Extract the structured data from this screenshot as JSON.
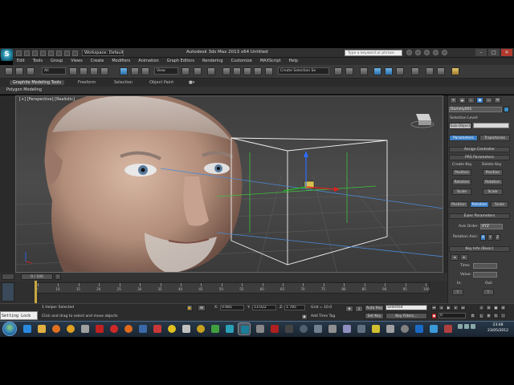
{
  "titlebar": {
    "app_logo": "S",
    "workspace": "Workspace: Default",
    "title": "Autodesk 3ds Max  2013 x64      Untitled",
    "search_placeholder": "Type a keyword or phrase",
    "window_controls": [
      "–",
      "□",
      "✕"
    ]
  },
  "menu": [
    "Edit",
    "Tools",
    "Group",
    "Views",
    "Create",
    "Modifiers",
    "Animation",
    "Graph Editors",
    "Rendering",
    "Customize",
    "MAXScript",
    "Help"
  ],
  "toolbar": {
    "selection_filter": "All",
    "reference_coord": "View",
    "named_selection": "Create Selection Se"
  },
  "ribbon": {
    "tabs": [
      "Graphite Modeling Tools",
      "Freeform",
      "Selection",
      "Object Paint"
    ],
    "active_tab": "Graphite Modeling Tools",
    "sub_label": "Polygon Modeling"
  },
  "viewport": {
    "label": "[+] [Perspective] [Realistic]"
  },
  "command_panel": {
    "object_name": "Dummy001",
    "object_color": "#3b8fc4",
    "selection_level": "Selection Level:",
    "sub_object": "Sub-Object",
    "param_tab": "Parameters",
    "traj_tab": "Trajectories",
    "assign_controller": "Assign Controller",
    "prs_params": "PRS Parameters",
    "create_key": "Create Key",
    "delete_key": "Delete Key",
    "position": "Position",
    "rotation": "Rotation",
    "scale": "Scale",
    "bottom_tabs": [
      "Position",
      "Rotation",
      "Scale"
    ],
    "euler_params": "Euler Parameters",
    "axis_order_label": "Axis Order:",
    "axis_order_value": "XYZ",
    "rotation_axis_label": "Rotation Axis:",
    "rotation_axes": [
      "X",
      "Y",
      "Z"
    ],
    "key_info": "Key Info (Basic)",
    "time_label": "Time:",
    "value_label": "Value:",
    "in_label": "In:",
    "out_label": "Out:"
  },
  "timeline": {
    "slider": "0 / 100",
    "ticks": [
      "0",
      "10",
      "15",
      "20",
      "25",
      "30",
      "35",
      "40",
      "45",
      "50",
      "55",
      "60",
      "65",
      "70",
      "75",
      "80",
      "85",
      "90",
      "95",
      "100"
    ]
  },
  "status": {
    "maxscript": "Setting Lock",
    "selected": "1 Helper Selected",
    "prompt": "Click and drag to select and move objects",
    "x_label": "X:",
    "x_value": "0.081",
    "y_label": "Y:",
    "y_value": "13.022",
    "z_label": "Z:",
    "z_value": "1.785",
    "grid": "Grid = 10.0",
    "add_time_tag": "Add Time Tag",
    "auto_key": "Auto Key",
    "set_key": "Set Key",
    "key_mode": "Selected",
    "key_filters": "Key Filters...",
    "frame": "0"
  },
  "taskbar": {
    "time": "23:48",
    "date": "23/05/2012"
  }
}
